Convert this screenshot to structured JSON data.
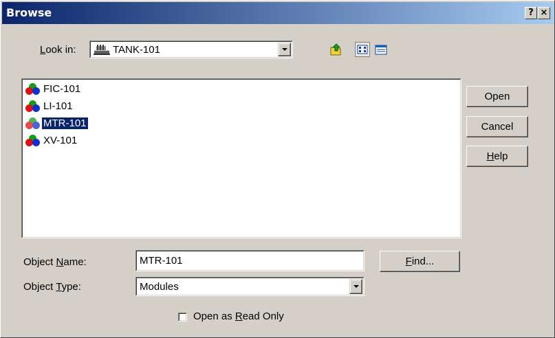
{
  "title": "Browse",
  "title_buttons": {
    "help": "?",
    "close": "×"
  },
  "look_in": {
    "label_prefix": "",
    "label_hot": "L",
    "label_rest": "ook in:",
    "value": "TANK-101",
    "icon": "tank-icon"
  },
  "toolbar": {
    "up_icon": "up-folder-icon",
    "list_icon": "list-view-icon",
    "details_icon": "details-view-icon"
  },
  "items": [
    {
      "label": "FIC-101",
      "selected": false
    },
    {
      "label": "LI-101",
      "selected": false
    },
    {
      "label": "MTR-101",
      "selected": true
    },
    {
      "label": "XV-101",
      "selected": false
    }
  ],
  "buttons": {
    "open": "Open",
    "cancel": "Cancel",
    "help_hot": "H",
    "help_rest": "elp",
    "find_hot": "F",
    "find_rest": "ind..."
  },
  "object_name": {
    "label_prefix": "Object ",
    "label_hot": "N",
    "label_rest": "ame:",
    "value": "MTR-101"
  },
  "object_type": {
    "label_prefix": "Object ",
    "label_hot": "T",
    "label_rest": "ype:",
    "value": "Modules"
  },
  "read_only": {
    "label_prefix": "Open as ",
    "label_hot": "R",
    "label_rest": "ead Only",
    "checked": false
  }
}
